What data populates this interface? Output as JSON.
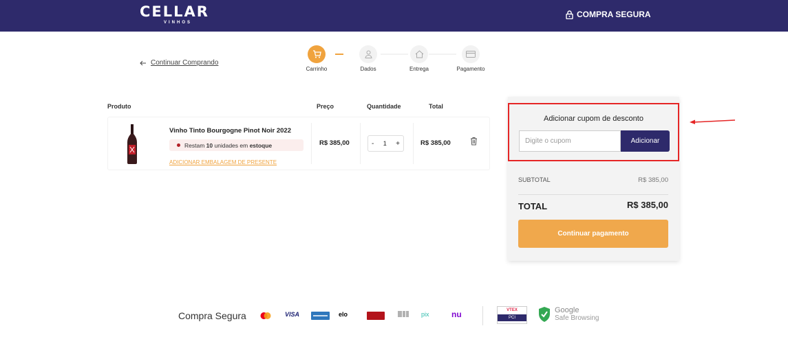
{
  "header": {
    "logo": "CELLAR",
    "logo_sub": "VINHOS",
    "secure_label": "COMPRA SEGURA"
  },
  "nav": {
    "back_label": "Continuar Comprando"
  },
  "steps": [
    {
      "label": "Carrinho",
      "icon": "cart-icon",
      "active": true
    },
    {
      "label": "Dados",
      "icon": "user-icon",
      "active": false
    },
    {
      "label": "Entrega",
      "icon": "home-icon",
      "active": false
    },
    {
      "label": "Pagamento",
      "icon": "card-icon",
      "active": false
    }
  ],
  "cart": {
    "headers": {
      "product": "Produto",
      "price": "Preço",
      "quantity": "Quantidade",
      "total": "Total"
    },
    "item": {
      "name": "Vinho Tinto Bourgogne Pinot Noir 2022",
      "stock_prefix": "Restam",
      "stock_count": "10",
      "stock_mid": "unidades em",
      "stock_suffix": "estoque",
      "gift_label": "ADICIONAR EMBALAGEM DE PRESENTE",
      "price": "R$ 385,00",
      "qty_minus": "-",
      "qty_value": "1",
      "qty_plus": "+",
      "total": "R$ 385,00"
    }
  },
  "summary": {
    "coupon_title": "Adicionar cupom de desconto",
    "coupon_placeholder": "Digite o cupom",
    "coupon_button": "Adicionar",
    "subtotal_label": "SUBTOTAL",
    "subtotal_value": "R$ 385,00",
    "total_label": "TOTAL",
    "total_value": "R$ 385,00",
    "pay_button": "Continuar pagamento"
  },
  "footer": {
    "title": "Compra Segura",
    "payment_methods": [
      "VISA",
      "elo",
      "pix",
      "nu"
    ],
    "vtex_top": "VTEX",
    "vtex_bottom": "PCI",
    "gsb_line1": "Google",
    "gsb_line2": "Safe Browsing"
  },
  "colors": {
    "brand": "#2e2a6b",
    "accent": "#f0a33e",
    "highlight": "#e52525"
  }
}
